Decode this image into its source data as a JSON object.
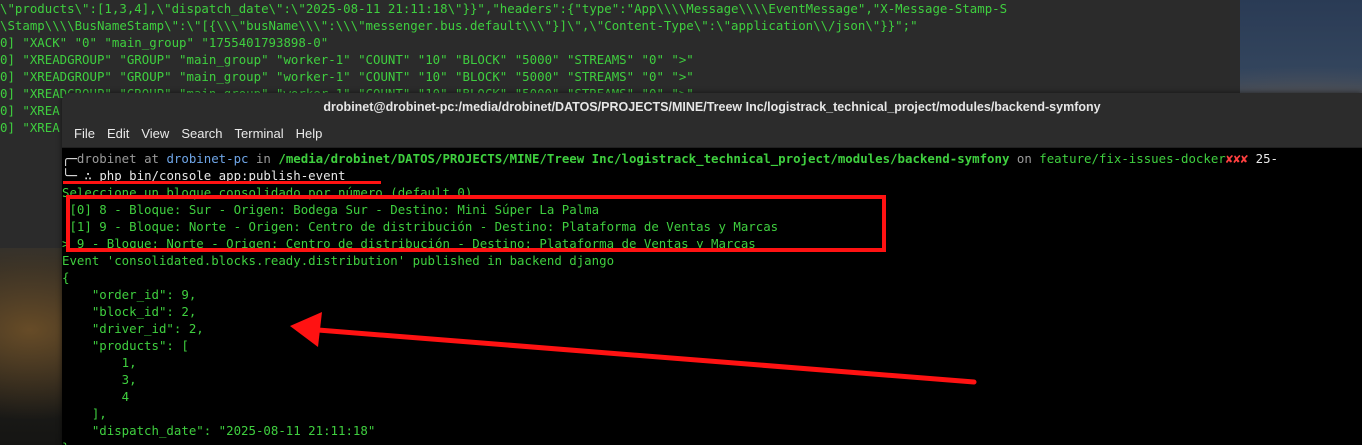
{
  "background_terminal": {
    "lines": [
      "\\\"products\\\":[1,3,4],\\\"dispatch_date\\\":\\\"2025-08-11 21:11:18\\\"}}\",\"headers\":{\"type\":\"App\\\\\\\\Message\\\\\\\\EventMessage\",\"X-Message-Stamp-S",
      "\\Stamp\\\\\\\\BusNameStamp\\\":\\\"[{\\\\\\\"busName\\\\\\\":\\\\\\\"messenger.bus.default\\\\\\\"}]\\\",\\\"Content-Type\\\":\\\"application\\\\/json\\\"}}\";\"",
      "0] \"XACK\" \"0\" \"main_group\" \"1755401793898-0\"",
      "0] \"XREADGROUP\" \"GROUP\" \"main_group\" \"worker-1\" \"COUNT\" \"10\" \"BLOCK\" \"5000\" \"STREAMS\" \"0\" \">\"",
      "0] \"XREADGROUP\" \"GROUP\" \"main_group\" \"worker-1\" \"COUNT\" \"10\" \"BLOCK\" \"5000\" \"STREAMS\" \"0\" \">\"",
      "0] \"XREADGROUP\" \"GROUP\" \"main_group\" \"worker-1\" \"COUNT\" \"10\" \"BLOCK\" \"5000\" \"STREAMS\" \"0\" \">\"",
      "0] \"XREA",
      "0] \"XREA"
    ]
  },
  "window": {
    "title": "drobinet@drobinet-pc:/media/drobinet/DATOS/PROJECTS/MINE/Treew Inc/logistrack_technical_project/modules/backend-symfony"
  },
  "menu": {
    "file": "File",
    "edit": "Edit",
    "view": "View",
    "search": "Search",
    "terminal": "Terminal",
    "help": "Help"
  },
  "prompt": {
    "corner_top": "╭─",
    "user": "drobinet",
    "at": " at ",
    "host": "drobinet-pc",
    "in": " in ",
    "path": "/media/drobinet/DATOS/PROJECTS/MINE/Treew Inc/logistrack_technical_project/modules/backend-symfony",
    "on": " on ",
    "branch": "feature/fix-issues-docker",
    "dirty": "✘✘✘",
    "time": " 25-",
    "corner_bottom": "╰─",
    "symbol": " ∴ ",
    "command": "php bin/console app:publish-event"
  },
  "output": {
    "question": "Seleccione un bloque consolidado por número (default 0)",
    "options": [
      " [0] 8 - Bloque: Sur - Origen: Bodega Sur - Destino: Mini Súper La Palma",
      " [1] 9 - Bloque: Norte - Origen: Centro de distribución - Destino: Plataforma de Ventas y Marcas",
      "> 9 - Bloque: Norte - Origen: Centro de distribución - Destino: Plataforma de Ventas y Marcas"
    ],
    "event_message": "Event 'consolidated.blocks.ready.distribution' published in backend django",
    "json_lines": [
      "{",
      "    \"order_id\": 9,",
      "    \"block_id\": 2,",
      "    \"driver_id\": 2,",
      "    \"products\": [",
      "        1,",
      "        3,",
      "        4",
      "    ],",
      "    \"dispatch_date\": \"2025-08-11 21:11:18\"",
      "}"
    ]
  },
  "colors": {
    "annotation": "#ff1212",
    "terminal_text": "#3fcf3f"
  }
}
